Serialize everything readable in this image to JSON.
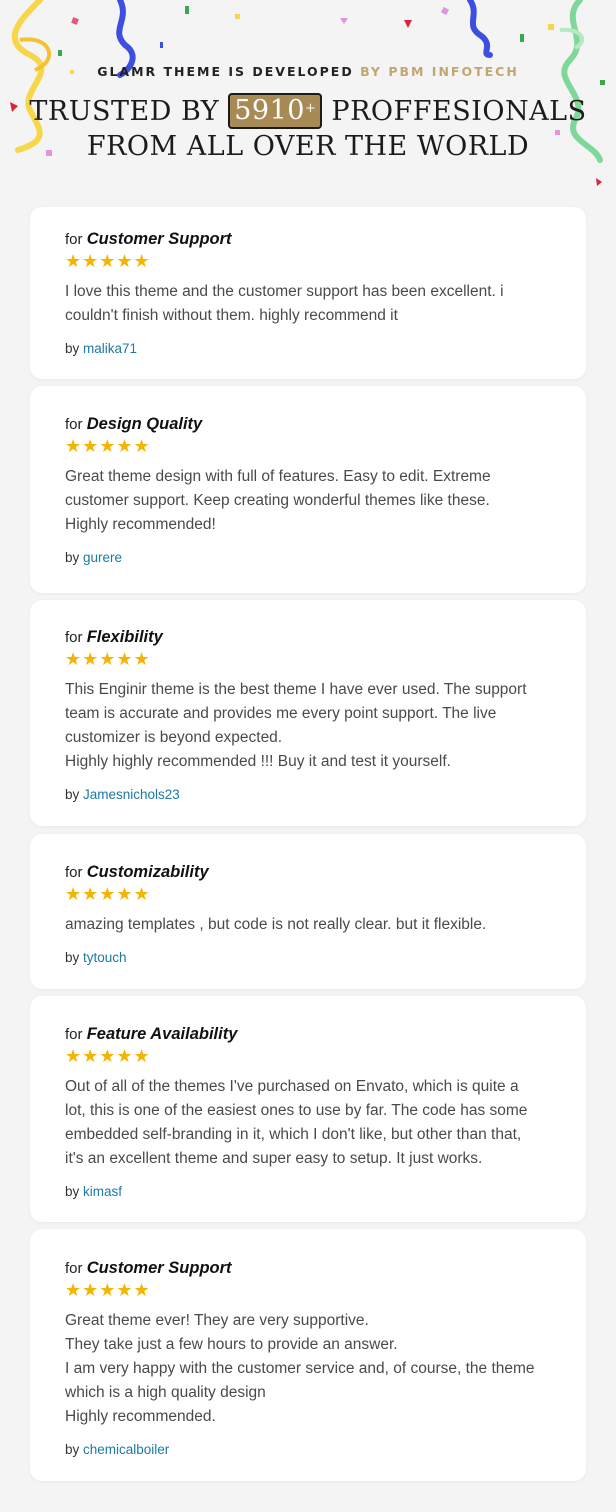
{
  "header": {
    "subtitle_main": "GLAMR THEME IS DEVELOPED ",
    "subtitle_accent": "BY PBM INFOTECH",
    "headline_pre": "TRUSTED BY ",
    "count": "5910",
    "count_suffix": "+",
    "headline_post": " PROFFESIONALS",
    "headline_line2": "FROM ALL OVER THE WORLD",
    "colors": {
      "accent": "#c3a66f",
      "badge": "#a88a55",
      "star": "#f4b400",
      "link": "#1d7aa3"
    }
  },
  "reviews": [
    {
      "for_label": "for ",
      "category": "Customer Support",
      "stars": "★★★★★",
      "rating": 5,
      "text": "I love this theme and the customer support has been excellent. i\ncouldn't finish without them. highly recommend it",
      "by_label": "by ",
      "author": "malika71"
    },
    {
      "for_label": "for ",
      "category": "Design Quality",
      "stars": "★★★★★",
      "rating": 5,
      "text": "Great theme design with full of features. Easy to edit. Extreme\ncustomer support. Keep creating wonderful themes like these.\nHighly recommended!",
      "by_label": "by ",
      "author": "gurere"
    },
    {
      "for_label": "for ",
      "category": "Flexibility",
      "stars": "★★★★★",
      "rating": 5,
      "text": "This Enginir theme is the best theme I have ever used. The support\nteam is accurate and provides me every point support. The live\ncustomizer is beyond expected.\nHighly highly recommended !!! Buy it and test it yourself.",
      "by_label": "by ",
      "author": "Jamesnichols23"
    },
    {
      "for_label": "for ",
      "category": "Customizability",
      "stars": "★★★★★",
      "rating": 5,
      "text": "amazing templates , but code is not really clear. but it flexible.",
      "by_label": "by ",
      "author": "tytouch"
    },
    {
      "for_label": "for ",
      "category": "Feature Availability",
      "stars": "★★★★★",
      "rating": 5,
      "text": "Out of all of the themes I've purchased on Envato, which is quite a\nlot, this is one of the easiest ones to use by far. The code has some\nembedded self-branding in it, which I don't like, but other than that,\nit's an excellent theme and super easy to setup. It just works.",
      "by_label": "by ",
      "author": "kimasf"
    },
    {
      "for_label": "for ",
      "category": "Customer Support",
      "stars": "★★★★★",
      "rating": 5,
      "text": "Great theme ever! They are very supportive.\nThey take just a few hours to provide an answer.\nI am very happy with the customer service and, of course, the theme\nwhich is a high quality design\nHighly recommended.",
      "by_label": "by ",
      "author": "chemicalboiler"
    }
  ]
}
